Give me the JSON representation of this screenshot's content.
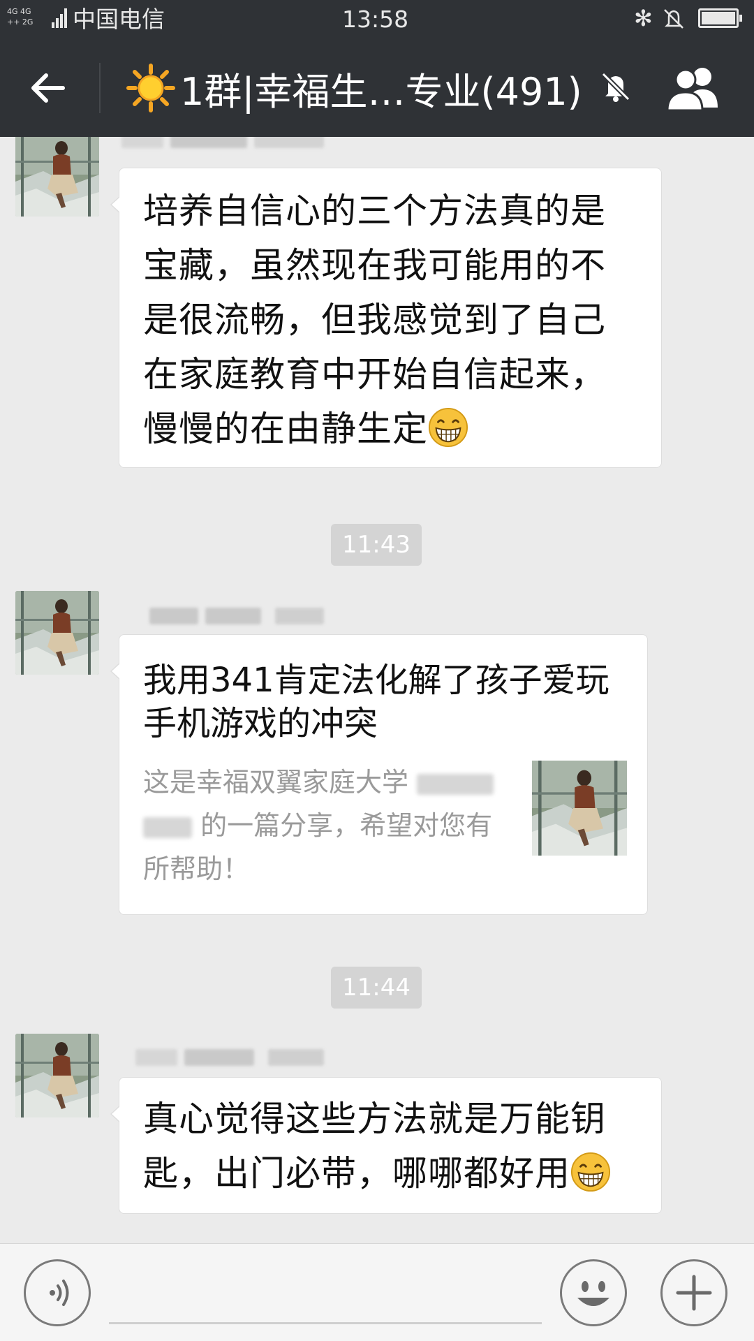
{
  "status_bar": {
    "network_top": "4G 4G",
    "network_bottom": "++ 2G",
    "carrier": "中国电信",
    "time": "13:58",
    "bluetooth_glyph": "✻"
  },
  "header": {
    "group_name": "1群|幸福生…专业(491)",
    "back_icon": "arrow-left-icon",
    "mute_icon": "bell-off-icon",
    "members_icon": "group-members-icon"
  },
  "messages": [
    {
      "type": "text",
      "lines": [
        "培养自信心的三个方法真的是",
        "宝藏，虽然现在我可能用的不",
        "是很流畅，但我感觉到了自己",
        "在家庭教育中开始自信起来，",
        "慢慢的在由静生定"
      ],
      "emoji": "grinning-face"
    },
    {
      "type": "time",
      "text": "11:43"
    },
    {
      "type": "link_card",
      "title": "我用341肯定法化解了孩子爱玩手机游戏的冲突",
      "desc_line1": "这是幸福双翼家庭大学",
      "desc_line2": "的一篇分享，希望对您有",
      "desc_line3": "所帮助！"
    },
    {
      "type": "time",
      "text": "11:44"
    },
    {
      "type": "text",
      "lines": [
        "真心觉得这些方法就是万能钥",
        "匙，出门必带，哪哪都好用"
      ],
      "emoji": "grinning-face"
    }
  ],
  "input_bar": {
    "voice_icon": "voice-wave-icon",
    "emoji_icon": "smiley-icon",
    "plus_icon": "plus-icon"
  },
  "colors": {
    "header_bg": "#2f3236",
    "chat_bg": "#ebebeb",
    "bubble_bg": "#ffffff",
    "time_pill_bg": "#d4d4d4"
  }
}
